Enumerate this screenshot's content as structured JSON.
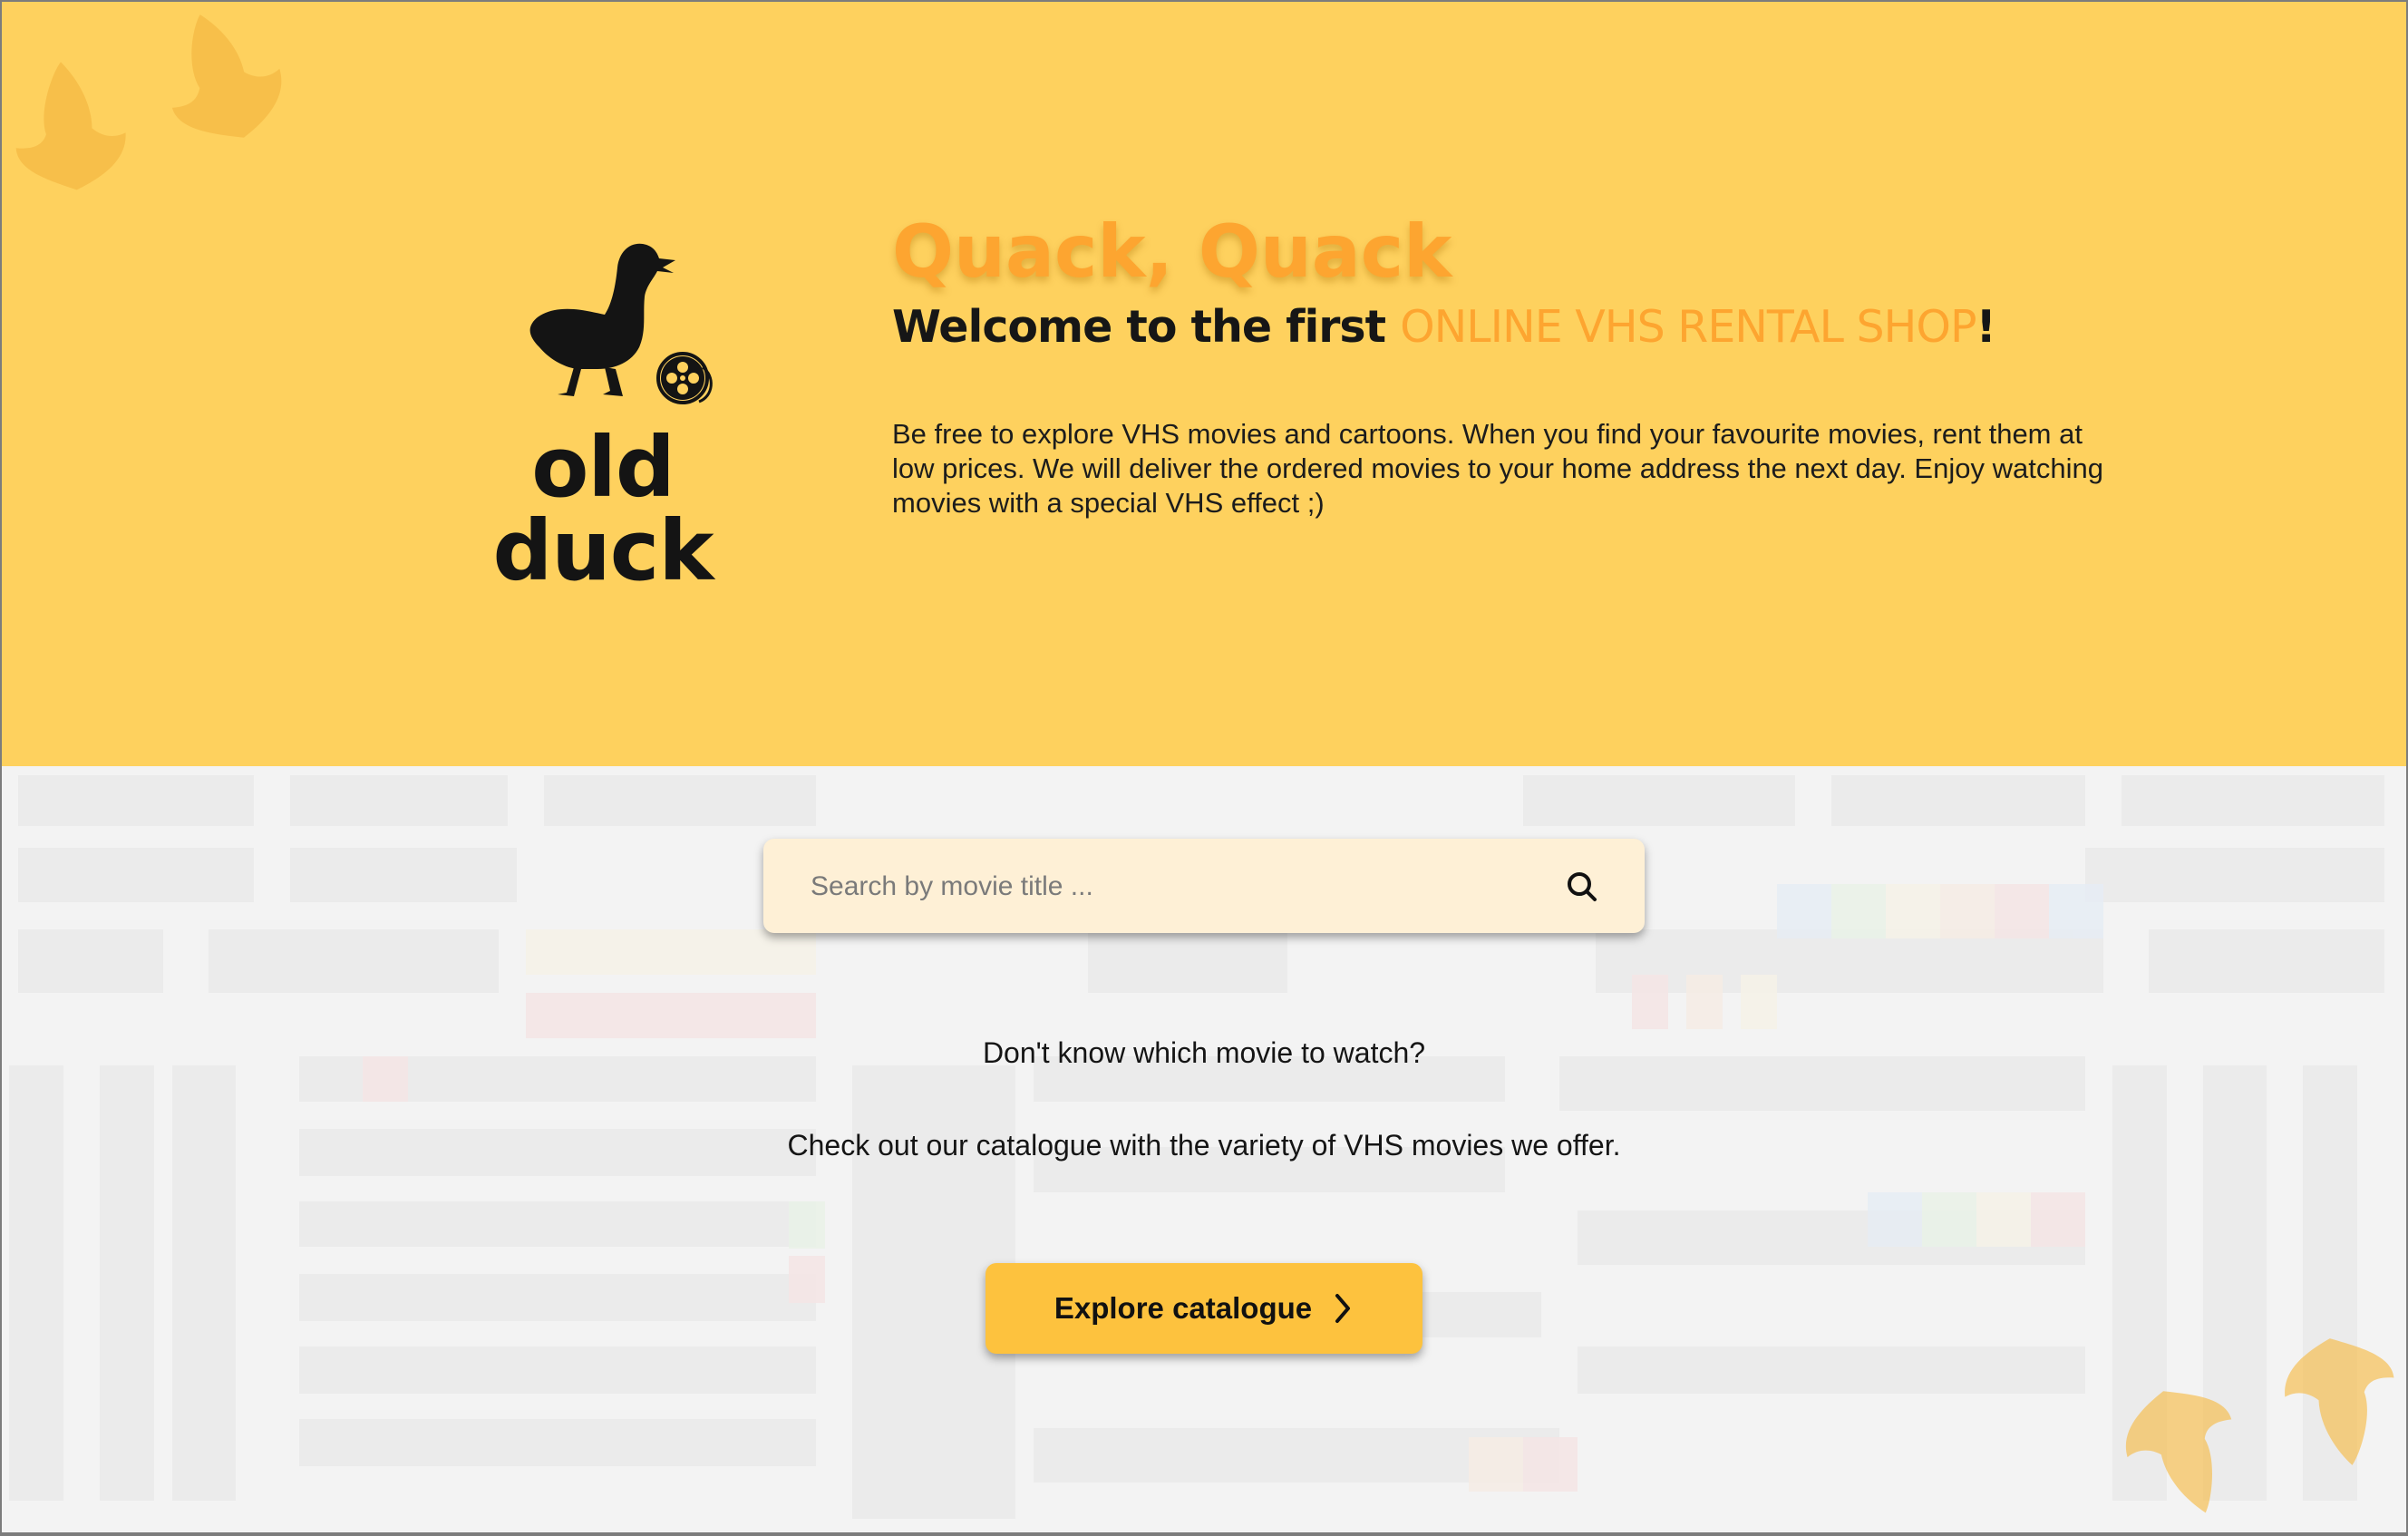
{
  "hero": {
    "logo_text": "old duck",
    "headline": "Quack, Quack",
    "welcome_prefix": "Welcome to the first ",
    "welcome_highlight": "ONLINE VHS RENTAL SHOP",
    "welcome_suffix": "!",
    "intro": "Be free to explore VHS movies and cartoons. When you find your favourite movies, rent them at low prices. We will deliver the ordered movies to your home address the next day. Enjoy watching movies with a special VHS effect ;)"
  },
  "search": {
    "placeholder": "Search by movie title ...",
    "value": "",
    "icon": "search-icon"
  },
  "prompt": {
    "question": "Don't know which movie to watch?",
    "suggestion": "Check out our catalogue with the variety of VHS movies we offer."
  },
  "cta": {
    "label": "Explore catalogue",
    "icon": "chevron-right-icon"
  },
  "colors": {
    "hero_background": "#FED15E",
    "accent": "#FDA530",
    "button": "#FDC23E",
    "search_background": "#FEF0D6",
    "text": "#161616"
  },
  "icons": [
    "duck-footprint-icon",
    "duck-logo-icon",
    "film-reel-icon",
    "search-icon",
    "chevron-right-icon"
  ]
}
